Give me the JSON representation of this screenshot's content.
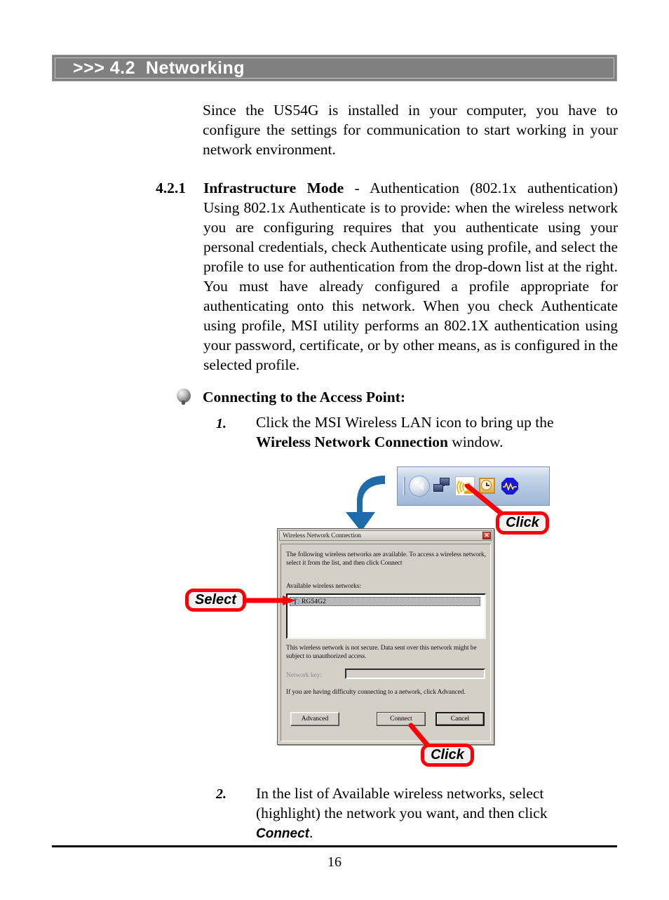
{
  "header": {
    "prefix": ">>>",
    "number": "4.2",
    "title": "Networking",
    "full_title": ">>> 4.2  Networking",
    "bar_color": "#808080",
    "text_color": "#ffffff"
  },
  "intro_paragraph": "Since the US54G is installed in your computer, you have to configure the settings for communication to start working in your network environment.",
  "subsection": {
    "number": "4.2.1",
    "heading": "Infrastructure Mode",
    "heading_tail": " - Authentication (802.1x authentication) Using 802.1x Authenticate is to provide: when the wireless network you are configuring requires that you authenticate using your personal credentials, check Authenticate using profile, and select the profile to use for authentication from the drop-down list at the right.  You must have already configured a profile appropriate for authenticating onto this network.  When you check Authenticate using profile, MSI utility performs an 802.1X authentication using your password, certificate, or by other means, as is configured in the selected profile."
  },
  "connecting": {
    "heading": "Connecting to the Access Point:",
    "bullet_icon": "sphere-bullet-icon",
    "steps": [
      {
        "number": "1.",
        "text_lead": "Click the MSI Wireless LAN icon to bring up the ",
        "text_bold": "Wireless Network Connection",
        "text_tail": " window."
      },
      {
        "number": "2.",
        "text_lead": "In the list of Available wireless networks, select (highlight) the network you want, and then click ",
        "text_bold": "Connect",
        "text_tail": "."
      }
    ]
  },
  "system_tray": {
    "icons": [
      "chevron-left-expand-icon",
      "network-connections-icon",
      "wireless-lan-antenna-icon",
      "clock-icon",
      "audio-waveform-icon"
    ]
  },
  "dialog": {
    "title": "Wireless Network Connection",
    "close_label": "✕",
    "intro_text": "The following wireless networks are available. To access a wireless network, select it from the list, and then click Connect",
    "available_label": "Available wireless networks:",
    "network_list": [
      {
        "ssid": "RG54G2",
        "selected": true,
        "icon": "wireless-network-icon"
      }
    ],
    "security_note": "This wireless network is not secure. Data sent over this network might be subject to unauthorized access.",
    "network_key_label": "Network key:",
    "network_key_value": "",
    "help_note": "If you are having difficulty connecting to a network, click Advanced.",
    "buttons": {
      "advanced": "Advanced",
      "connect": "Connect",
      "cancel": "Cancel"
    }
  },
  "callouts": {
    "click_tray": "Click",
    "select_network": "Select",
    "click_connect": "Click",
    "border_color": "#fb0007",
    "arrow_color": "#1f6aa8"
  },
  "footer": {
    "page_number": "16"
  }
}
